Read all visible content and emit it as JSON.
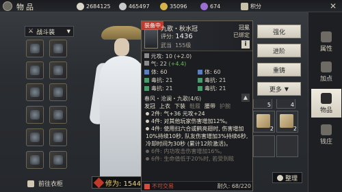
{
  "header": {
    "title": "物品",
    "currencies": [
      {
        "icon": "jade-coin-icon",
        "value": "2684125",
        "color": "#d9d4c8"
      },
      {
        "icon": "silver-coin-icon",
        "value": "465497",
        "color": "#c9c9c9"
      },
      {
        "icon": "gold-coin-icon",
        "value": "35096",
        "color": "#d6b34a"
      },
      {
        "icon": "purple-gem-icon",
        "value": "674",
        "color": "#9b6fd1"
      }
    ],
    "points_label": "积分"
  },
  "left": {
    "dropdown_label": "战斗装",
    "closet_label": "前往衣柜"
  },
  "character": {
    "cultivation_label": "修为: 1544"
  },
  "tooltip": {
    "equipped_badge": "装备中",
    "item_name": "九歌・秋水冠",
    "slot_type": "冠冕",
    "bound_status": "已绑定",
    "score_label": "评分:",
    "score_value": "1436",
    "school": "武当",
    "level": "155级",
    "stats": [
      {
        "text": "元攻: 10 (+2.0)",
        "plus": ""
      },
      {
        "text": "气: 22 ",
        "plus": "(+4.4)"
      }
    ],
    "gems": [
      "体: 60",
      "体: 60",
      "毒抗: 21",
      "毒抗: 21",
      "毒抗: 21",
      "毒抗: 21"
    ],
    "set_name": "春风・沧澜・九歌(4/6)",
    "set_parts": [
      {
        "label": "发冠",
        "active": true
      },
      {
        "label": "上衣",
        "active": true
      },
      {
        "label": "下装",
        "active": true
      },
      {
        "label": "鞋履",
        "active": false
      },
      {
        "label": "腰带",
        "active": true
      },
      {
        "label": "护腕",
        "active": false
      }
    ],
    "set_effects": [
      {
        "text": "2件: 气+36 元攻+24",
        "active": true
      },
      {
        "text": "4件: 对其他玩家伤害增加12%。",
        "active": true
      },
      {
        "text": "4件: 使用扫六合或鹤亮翅时, 伤害增加10%持续10秒, 队友伤害增加3%持续6秒, 冷却时间为30秒 (累计12阶激活)。",
        "active": true
      },
      {
        "text": "6件: 内功攻击伤害增加16%。",
        "active": false
      },
      {
        "text": "6件: 生命值低于20%时, 若受到眩",
        "active": false
      }
    ],
    "no_trade": "不可交易",
    "durability": "耐久: 68/220"
  },
  "actions": {
    "enhance": "强化",
    "advance": "进阶",
    "reforge": "重铸",
    "more": "更多"
  },
  "inventory": {
    "slot_counts": [
      "5",
      "4",
      "2",
      "2"
    ],
    "arrange_label": "整理"
  },
  "tabs": [
    {
      "label": "属性",
      "active": false
    },
    {
      "label": "加点",
      "active": false
    },
    {
      "label": "物品",
      "active": true
    },
    {
      "label": "钱庄",
      "active": false
    }
  ]
}
